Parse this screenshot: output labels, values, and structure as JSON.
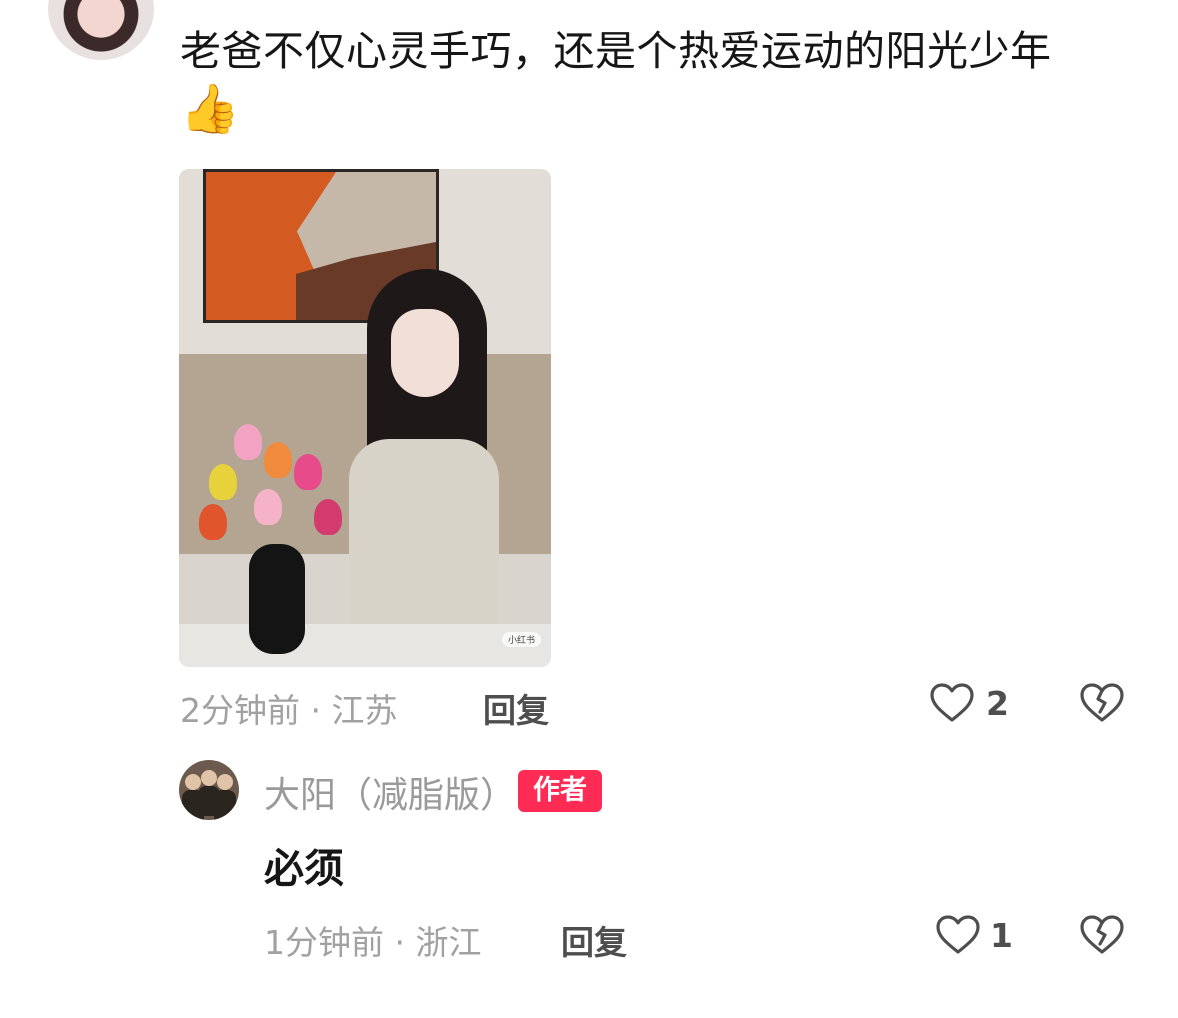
{
  "comment": {
    "text": "老爸不仅心灵手巧，还是个热爱运动的阳光少年",
    "emoji": "👍",
    "image_watermark": "小红书",
    "time": "2分钟前",
    "location": "江苏",
    "reply_label": "回复",
    "like_count": "2"
  },
  "reply": {
    "author": "大阳（减脂版）",
    "badge": "作者",
    "text": "必须",
    "time": "1分钟前",
    "location": "浙江",
    "reply_label": "回复",
    "like_count": "1"
  },
  "colors": {
    "badge": "#fe2c55",
    "primary_text": "#161616",
    "secondary_text": "#a1a1a1",
    "action_text": "#4e4e4e"
  },
  "icons": [
    "heart-icon",
    "broken-heart-icon"
  ]
}
